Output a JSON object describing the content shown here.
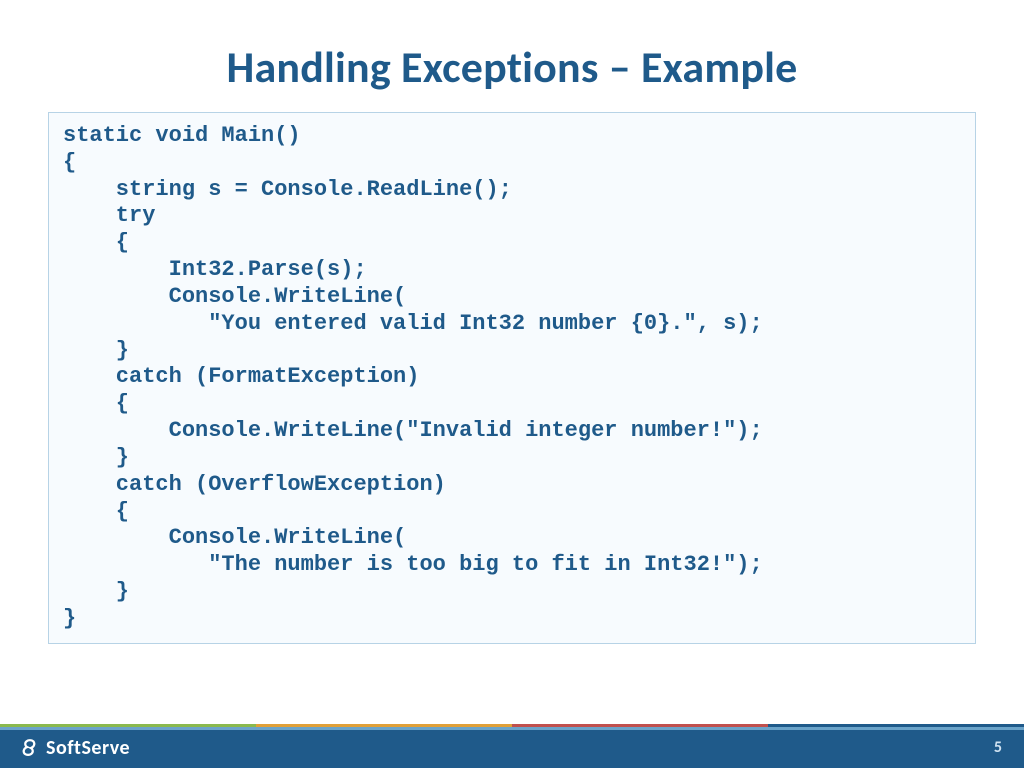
{
  "title": "Handling Exceptions – Example",
  "code": "static void Main()\n{\n    string s = Console.ReadLine();\n    try\n    {\n        Int32.Parse(s);\n        Console.WriteLine(\n           \"You entered valid Int32 number {0}.\", s);\n    }\n    catch (FormatException)\n    {\n        Console.WriteLine(\"Invalid integer number!\");\n    }\n    catch (OverflowException)\n    {\n        Console.WriteLine(\n           \"The number is too big to fit in Int32!\");\n    }\n}",
  "footer": {
    "brand": "SoftServe",
    "page": "5"
  }
}
